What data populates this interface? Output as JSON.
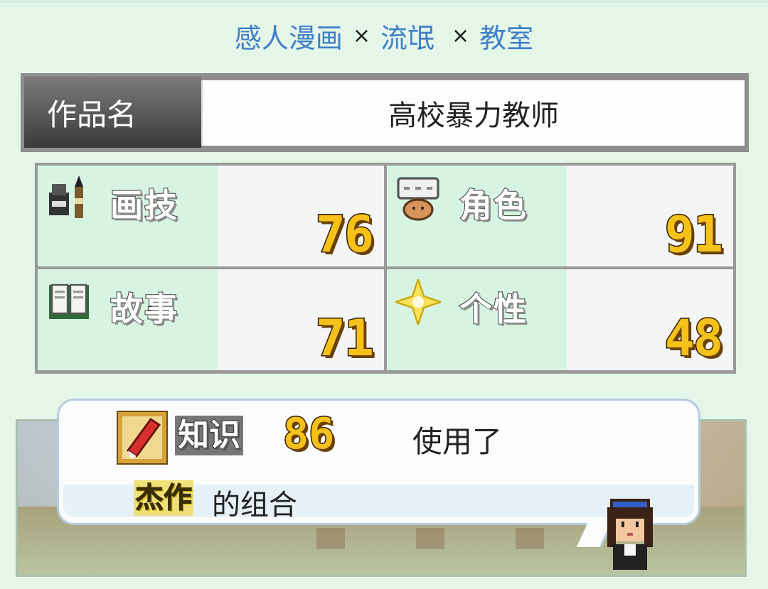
{
  "combo": {
    "part1": "感人漫画",
    "sep1": "×",
    "part2": "流氓",
    "sep2": "×",
    "part3": "教室"
  },
  "title": {
    "label": "作品名",
    "value": "高校暴力教师"
  },
  "stats": [
    {
      "label": "画技",
      "value": "76",
      "icon": "pen-ink-icon"
    },
    {
      "label": "角色",
      "value": "91",
      "icon": "speech-character-icon"
    },
    {
      "label": "故事",
      "value": "71",
      "icon": "open-book-icon"
    },
    {
      "label": "个性",
      "value": "48",
      "icon": "sparkle-icon"
    }
  ],
  "message": {
    "skill": "知识",
    "skill_value": "86",
    "used_text": "使用了",
    "genre_tag": "杰作",
    "genre_suffix": "的组合",
    "icon": "red-book-icon"
  },
  "colors": {
    "combo_text": "#3f7fc8",
    "number_fill": "#f6c21a",
    "panel_tint": "#d7f4e3"
  }
}
